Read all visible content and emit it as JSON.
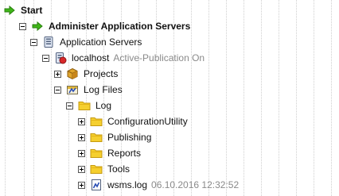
{
  "tree": {
    "start": {
      "label": "Start",
      "icon": "green-arrow-icon"
    },
    "admin_servers": {
      "label": "Administer Application Servers",
      "icon": "green-arrow-icon"
    },
    "app_servers": {
      "label": "Application Servers",
      "icon": "server-icon"
    },
    "localhost": {
      "label": "localhost",
      "status": "Active-Publication On",
      "icon": "server-red-icon"
    },
    "projects": {
      "label": "Projects",
      "icon": "package-icon"
    },
    "log_files": {
      "label": "Log Files",
      "icon": "log-files-icon"
    },
    "log": {
      "label": "Log",
      "icon": "folder-icon"
    },
    "log_children": [
      {
        "label": "ConfigurationUtility",
        "icon": "folder-icon"
      },
      {
        "label": "Publishing",
        "icon": "folder-icon"
      },
      {
        "label": "Reports",
        "icon": "folder-icon"
      },
      {
        "label": "Tools",
        "icon": "folder-icon"
      }
    ],
    "wsms_log": {
      "label": "wsms.log",
      "timestamp": "06.10.2016 12:32:52",
      "icon": "log-file-icon"
    }
  },
  "colors": {
    "arrow_green": "#3fb618",
    "folder_yellow": "#f5cf2f",
    "muted_text": "#8a8a8a"
  }
}
